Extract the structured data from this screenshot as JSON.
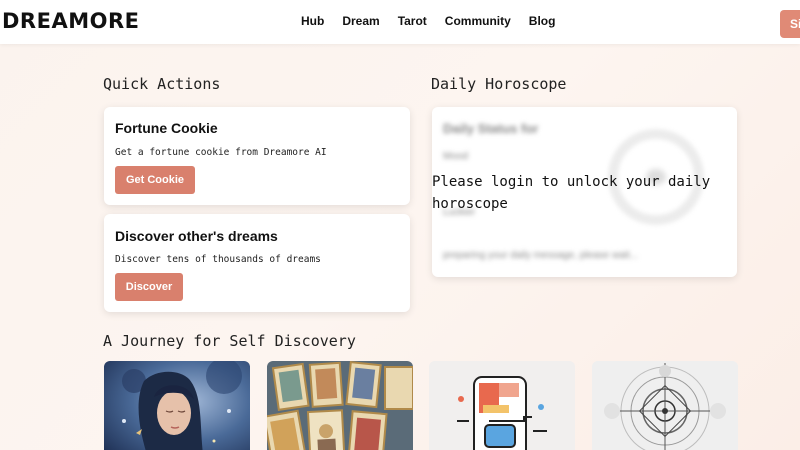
{
  "header": {
    "logo": "DREAMORE",
    "nav": [
      "Hub",
      "Dream",
      "Tarot",
      "Community",
      "Blog"
    ],
    "cta_label": "Si"
  },
  "quick_actions": {
    "title": "Quick Actions",
    "cards": [
      {
        "title": "Fortune Cookie",
        "desc": "Get a fortune cookie from Dreamore AI",
        "button": "Get Cookie"
      },
      {
        "title": "Discover other's dreams",
        "desc": "Discover tens of thousands of dreams",
        "button": "Discover"
      }
    ]
  },
  "horoscope": {
    "title": "Daily Horoscope",
    "blurred_heading": "Daily Status for",
    "blurred_mood": "Mood",
    "blurred_label": "Luckier",
    "blurred_footer": "preparing your daily message, please wait...",
    "lock_message": "Please login to unlock your daily horoscope"
  },
  "journey": {
    "title": "A Journey for Self Discovery"
  },
  "colors": {
    "accent": "#d9806d",
    "background": "#fbf3ee"
  }
}
